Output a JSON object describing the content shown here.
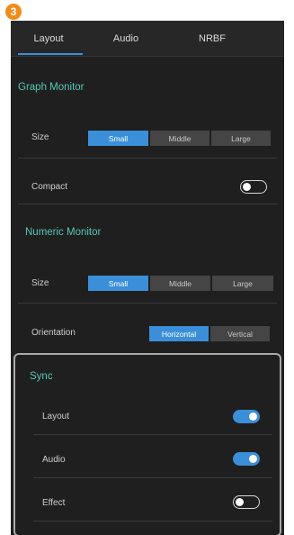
{
  "step_number": "3",
  "tabs": [
    {
      "label": "Layout",
      "active": true
    },
    {
      "label": "Audio",
      "active": false
    },
    {
      "label": "NRBF",
      "active": false
    }
  ],
  "graph_monitor": {
    "title": "Graph Monitor",
    "size_label": "Size",
    "size_options": [
      "Small",
      "Middle",
      "Large"
    ],
    "size_selected": "Small",
    "compact_label": "Compact",
    "compact_on": false
  },
  "numeric_monitor": {
    "title": "Numeric Monitor",
    "size_label": "Size",
    "size_options": [
      "Small",
      "Middle",
      "Large"
    ],
    "size_selected": "Small",
    "orientation_label": "Orientation",
    "orientation_options": [
      "Horizontal",
      "Vertical"
    ],
    "orientation_selected": "Horizontal"
  },
  "sync": {
    "title": "Sync",
    "items": [
      {
        "label": "Layout",
        "on": true
      },
      {
        "label": "Audio",
        "on": true
      },
      {
        "label": "Effect",
        "on": false
      }
    ]
  },
  "colors": {
    "accent": "#3b8fd9",
    "section_title": "#58c7b7",
    "panel_bg": "#1f1f1f",
    "badge": "#f08c1c"
  }
}
